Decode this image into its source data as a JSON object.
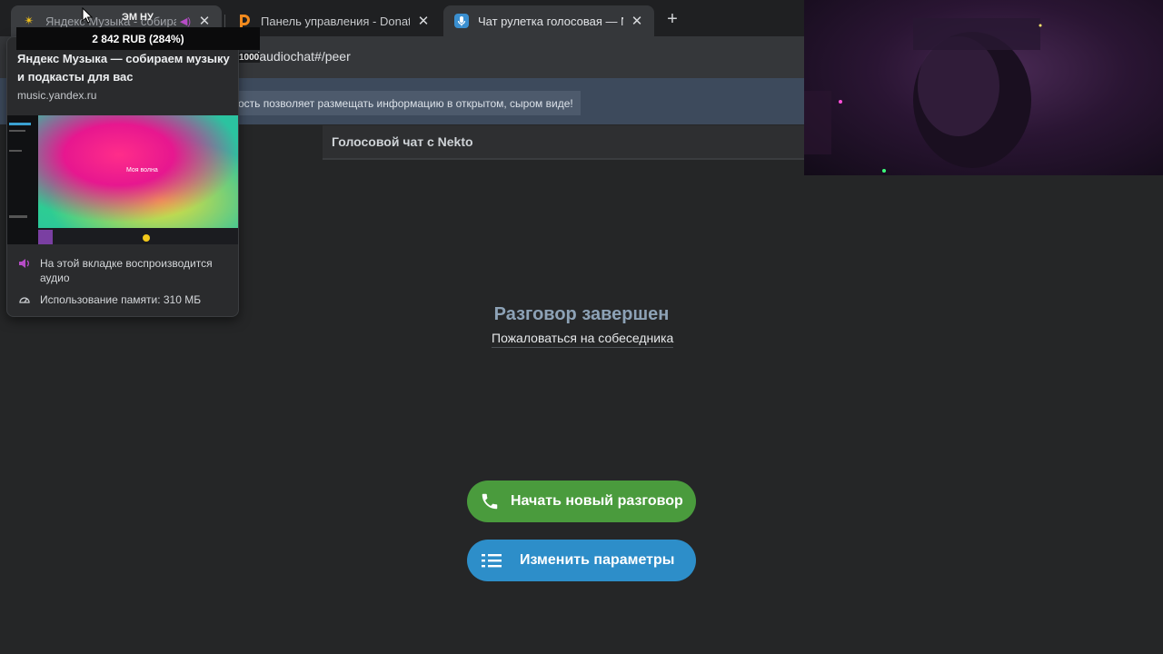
{
  "tabs": [
    {
      "title": "Яндекс Музыка - собираем музыку",
      "favicon": "yandex-music-icon",
      "playing_audio": true
    },
    {
      "title": "Панель управления - DonationAlerts",
      "favicon": "donationalerts-icon"
    },
    {
      "title": "Чат рулетка голосовая — Nekto",
      "favicon": "microphone-icon",
      "active": true
    }
  ],
  "toolbar": {
    "url": "nekto.me/audiochat#/peer",
    "url_visible": "me/audiochat#/peer"
  },
  "overlay": {
    "donation_total": "2 842 RUB (284%)",
    "em_label": "ЭМ НУ",
    "port": "1000"
  },
  "warning": {
    "text": "ость позволяет размещать информацию в открытом, сыром виде!"
  },
  "site": {
    "header": "Голосовой чат с Nekto"
  },
  "conversation": {
    "status_title": "Разговор завершен",
    "report_link": "Пожаловаться на собеседника"
  },
  "buttons": {
    "new_chat": "Начать новый разговор",
    "change_params": "Изменить параметры"
  },
  "hovercard": {
    "title": "Яндекс Музыка — собираем музыку и подкасты для вас",
    "url": "music.yandex.ru",
    "preview_text": "Моя волна",
    "audio_note": "На этой вкладке воспроизводится аудио",
    "memory": "Использование памяти: 310 МБ"
  },
  "colors": {
    "page_bg": "#252627",
    "green_button": "#4a9b3d",
    "blue_button": "#2d8ec9",
    "status_title": "#8da2b6",
    "warning_bar": "#3d4a5c"
  }
}
